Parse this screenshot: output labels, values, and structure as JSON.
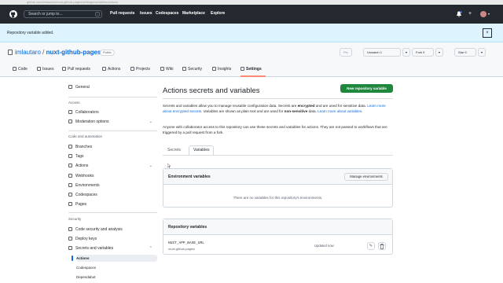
{
  "browser": {
    "url": "github.com/imlautaro/nuxt-github-pages/settings/variables/actions"
  },
  "topnav": {
    "search_placeholder": "Search or jump to...",
    "slash_key": "/",
    "links": [
      "Pull requests",
      "Issues",
      "Codespaces",
      "Marketplace",
      "Explore"
    ],
    "plus_glyph": "+",
    "caret_glyph": "▾"
  },
  "flash": {
    "message": "Repository variable added.",
    "close_glyph": "×"
  },
  "repo": {
    "owner": "imlautaro",
    "separator": "/",
    "name": "nuxt-github-pages",
    "visibility": "Public",
    "actions": {
      "pin": "Pin",
      "unwatch": "Unwatch",
      "unwatch_count": "1",
      "fork": "Fork",
      "fork_count": "0",
      "star": "Star",
      "star_count": "0",
      "caret": "▾"
    },
    "tabs": [
      "Code",
      "Issues",
      "Pull requests",
      "Actions",
      "Projects",
      "Wiki",
      "Security",
      "Insights",
      "Settings"
    ]
  },
  "sidebar": {
    "general": "General",
    "access_heading": "Access",
    "collaborators": "Collaborators",
    "moderation": "Moderation options",
    "code_heading": "Code and automation",
    "branches": "Branches",
    "tags": "Tags",
    "actions": "Actions",
    "webhooks": "Webhooks",
    "environments": "Environments",
    "codespaces": "Codespaces",
    "pages": "Pages",
    "security_heading": "Security",
    "code_security": "Code security and analysis",
    "deploy_keys": "Deploy keys",
    "secrets_vars": "Secrets and variables",
    "sub_actions": "Actions",
    "sub_codespaces": "Codespaces",
    "sub_dependabot": "Dependabot",
    "chevron_down": "⌄",
    "chevron_up": "⌃"
  },
  "main": {
    "title": "Actions secrets and variables",
    "new_button": "New repository variable",
    "desc1_a": "Secrets and variables allow you to manage reusable configuration data. Secrets are ",
    "desc1_b": "encrypted",
    "desc1_c": " and are used for sensitive data. ",
    "desc1_link1": "Learn more about encrypted secrets",
    "desc1_d": ". Variables are shown as plain text and are used for ",
    "desc1_e": "non-sensitive",
    "desc1_f": " data. ",
    "desc1_link2": "Learn more about variables",
    "desc1_g": ".",
    "desc2": "Anyone with collaborator access to this repository can use these secrets and variables for actions. They are not passed to workflows that are triggered by a pull request from a fork.",
    "tab_secrets": "Secrets",
    "tab_variables": "Variables",
    "env_title": "Environment variables",
    "manage_env_button": "Manage environments",
    "env_empty": "There are no variables for this repository's environments.",
    "repo_vars_title": "Repository variables",
    "variables": [
      {
        "name": "NUXT_APP_BASE_URL",
        "value": "/nuxt-github-pages/",
        "updated": "Updated now"
      }
    ],
    "edit_glyph": "✎",
    "delete_glyph": "🗑"
  },
  "colors": {
    "primary_button": "#1f883d",
    "link": "#0969da",
    "topnav": "#24292f",
    "flash_bg": "#ddf4ff"
  }
}
